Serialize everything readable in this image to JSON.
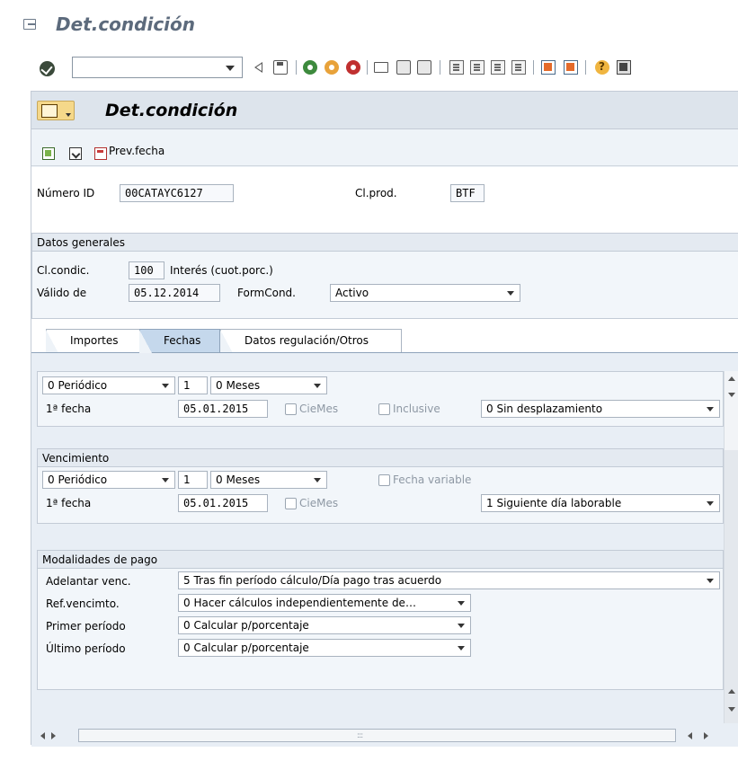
{
  "window": {
    "title": "Det.condición"
  },
  "toolbar": {
    "icons": [
      "check-icon",
      "back-icon",
      "save-icon",
      "back-nav-icon",
      "exit-nav-icon",
      "cancel-icon",
      "print-icon",
      "find-icon",
      "find-next-icon",
      "first-page-icon",
      "previous-page-icon",
      "next-page-icon",
      "last-page-icon",
      "create-session-icon",
      "shortcut-icon",
      "help-icon",
      "customize-layout-icon"
    ]
  },
  "screen": {
    "title": "Det.condición",
    "app_toolbar": {
      "prev_fecha_label": "Prev.fecha"
    }
  },
  "header_fields": {
    "numero_id": {
      "label": "Número ID",
      "value": "00CATAYC6127"
    },
    "clprod": {
      "label": "Cl.prod.",
      "value": "BTF"
    }
  },
  "datos_generales": {
    "title": "Datos generales",
    "clcondic": {
      "label": "Cl.condic.",
      "value": "100",
      "text": "Interés (cuot.porc.)"
    },
    "valido_de": {
      "label": "Válido de",
      "value": "05.12.2014"
    },
    "formcond": {
      "label": "FormCond.",
      "value": "Activo"
    }
  },
  "tabs": [
    {
      "label": "Importes",
      "active": false
    },
    {
      "label": "Fechas",
      "active": true
    },
    {
      "label": "Datos regulación/Otros",
      "active": false
    }
  ],
  "periodo_group": {
    "frequency": "0 Periódico",
    "count": "1",
    "unit": "0 Meses",
    "first_date_label": "1ª fecha",
    "first_date": "05.01.2015",
    "ciemes_label": "CieMes",
    "inclusive_label": "Inclusive",
    "shift": "0 Sin desplazamiento"
  },
  "vencimiento": {
    "title": "Vencimiento",
    "frequency": "0 Periódico",
    "count": "1",
    "unit": "0 Meses",
    "fecha_variable_label": "Fecha variable",
    "first_date_label": "1ª fecha",
    "first_date": "05.01.2015",
    "ciemes_label": "CieMes",
    "shift": "1 Siguiente día laborable"
  },
  "modalidades": {
    "title": "Modalidades de pago",
    "rows": [
      {
        "label": "Adelantar venc.",
        "value": "5 Tras fin período cálculo/Día pago tras acuerdo"
      },
      {
        "label": "Ref.vencimto.",
        "value": "0 Hacer cálculos independientemente de…"
      },
      {
        "label": "Primer período",
        "value": "0 Calcular p/porcentaje"
      },
      {
        "label": "Último período",
        "value": "0 Calcular p/porcentaje"
      }
    ]
  },
  "scroll": {
    "grip": ":::"
  }
}
